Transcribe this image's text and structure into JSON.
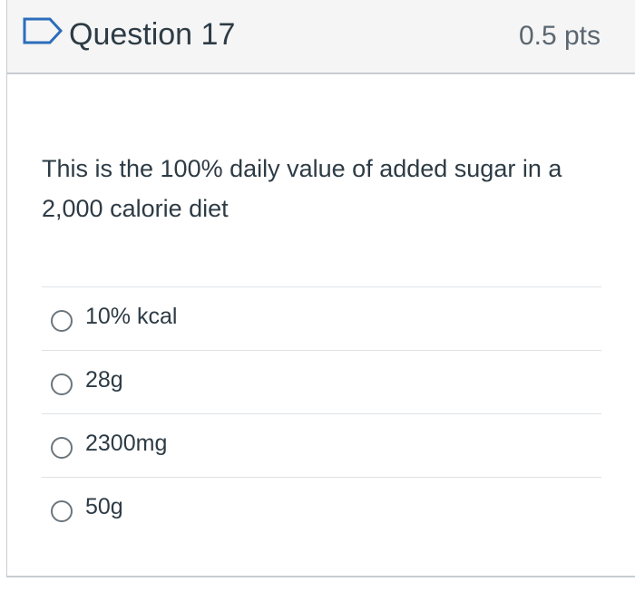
{
  "question": {
    "title": "Question 17",
    "points": "0.5 pts",
    "flag_icon": "flag-icon",
    "text": "This is the 100% daily value of added sugar in a 2,000 calorie diet",
    "selected": null,
    "answers": [
      {
        "label": "10% kcal"
      },
      {
        "label": "28g"
      },
      {
        "label": "2300mg"
      },
      {
        "label": "50g"
      }
    ]
  },
  "colors": {
    "header_bg": "#f5f5f5",
    "border": "#c7cdd1",
    "flag": "#2c6dbb",
    "text": "#2d3b45"
  }
}
